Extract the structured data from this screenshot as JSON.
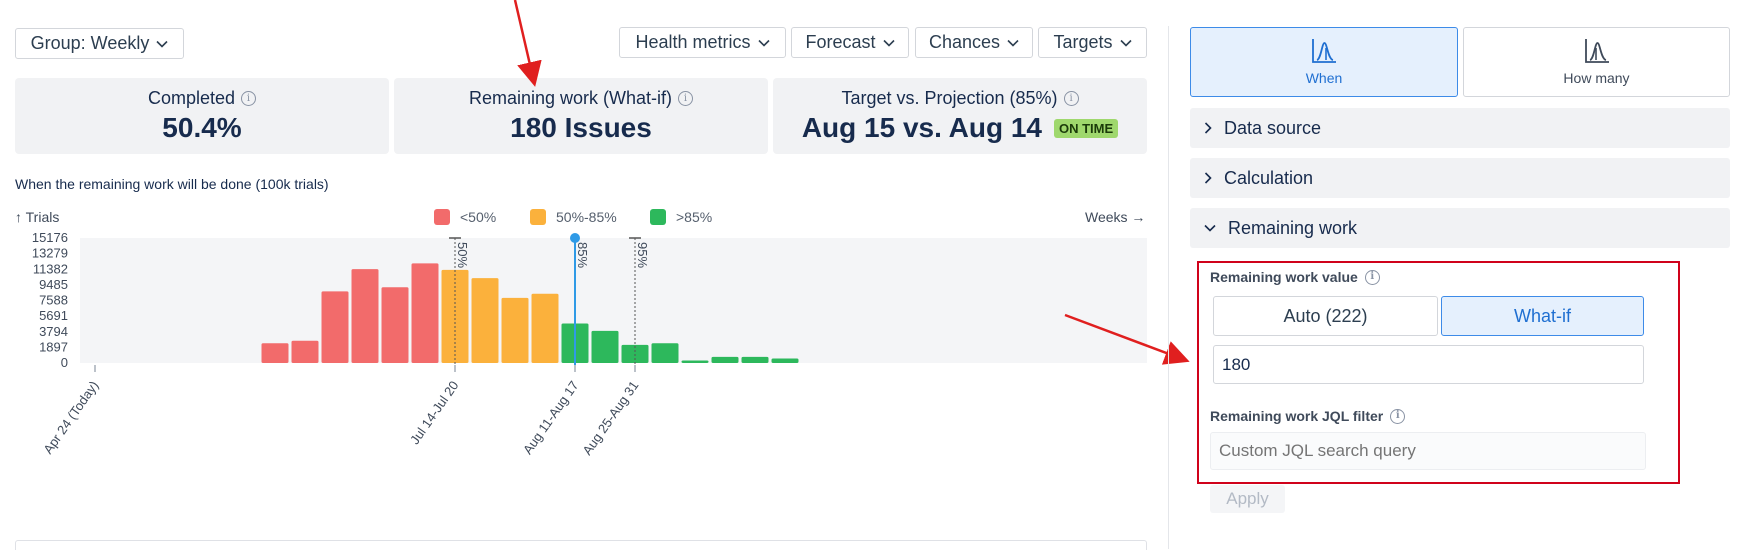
{
  "toolbar": {
    "group_label": "Group: Weekly",
    "health_label": "Health metrics",
    "forecast_label": "Forecast",
    "chances_label": "Chances",
    "targets_label": "Targets"
  },
  "cards": {
    "completed": {
      "label": "Completed",
      "value": "50.4%"
    },
    "remaining": {
      "label": "Remaining work (What-if)",
      "value": "180 Issues"
    },
    "target": {
      "label": "Target vs. Projection (85%)",
      "value": "Aug 15 vs. Aug 14",
      "badge": "ON TIME"
    }
  },
  "chart": {
    "title": "When the remaining work will be done (100k trials)",
    "y_axis_label": "↑ Trials",
    "x_axis_label": "Weeks →",
    "legend": [
      {
        "label": "<50%",
        "color": "#f26b6b"
      },
      {
        "label": "50%-85%",
        "color": "#fbb13c"
      },
      {
        "label": ">85%",
        "color": "#2db85c"
      }
    ]
  },
  "chart_data": {
    "type": "bar",
    "y_ticks": [
      "15176",
      "13279",
      "11382",
      "9485",
      "7588",
      "5691",
      "3794",
      "1897",
      "0"
    ],
    "ylim": [
      0,
      15176
    ],
    "x_tick_labels": [
      "Apr 24 (Today)",
      "Jul 14-Jul 20",
      "Aug 11-Aug 17",
      "Aug 25-Aug 31"
    ],
    "x_tick_weeks": [
      0,
      12,
      16,
      18
    ],
    "weeks": [
      6,
      7,
      8,
      9,
      10,
      11,
      12,
      13,
      14,
      15,
      16,
      17,
      18,
      19,
      20,
      21,
      22,
      23
    ],
    "values": [
      2400,
      2700,
      8700,
      11400,
      9200,
      12100,
      11300,
      10300,
      7900,
      8400,
      4800,
      3900,
      2200,
      2400,
      300,
      750,
      750,
      550
    ],
    "bands": [
      "<50%",
      "<50%",
      "<50%",
      "<50%",
      "<50%",
      "<50%",
      "50%-85%",
      "50%-85%",
      "50%-85%",
      "50%-85%",
      ">85%",
      ">85%",
      ">85%",
      ">85%",
      ">85%",
      ">85%",
      ">85%",
      ">85%"
    ],
    "markers": [
      {
        "label": "50%",
        "week": 12
      },
      {
        "label": "85%",
        "week": 16
      },
      {
        "label": "95%",
        "week": 18
      }
    ]
  },
  "panel": {
    "modes": [
      {
        "label": "When",
        "icon": "chart-when-icon"
      },
      {
        "label": "How many",
        "icon": "chart-howmany-icon"
      }
    ],
    "sections": {
      "data_source": "Data source",
      "calculation": "Calculation",
      "remaining_work": "Remaining work"
    },
    "value_label": "Remaining work value",
    "auto_label": "Auto (222)",
    "whatif_label": "What-if",
    "value_input": "180",
    "jql_label": "Remaining work JQL filter",
    "jql_placeholder": "Custom JQL search query",
    "apply_label": "Apply"
  },
  "colors": {
    "accent": "#1f6fd1",
    "highlight_border": "#d0021b",
    "arrow": "#e01f1f"
  }
}
